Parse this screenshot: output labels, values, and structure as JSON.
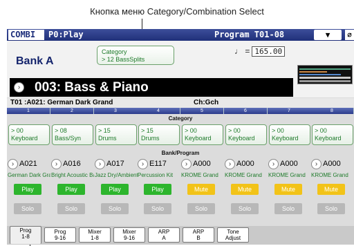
{
  "caption": "Кнопка меню Category/Combination Select",
  "header": {
    "mode": "COMBI",
    "page": "P0:Play",
    "program": "Program T01-08",
    "menu_icon": "chevron-down-icon",
    "lock_icon": "lock-icon"
  },
  "top": {
    "bank_label": "Bank A",
    "category_line1": "Category",
    "category_line2": "> 12 BassSplits",
    "tempo_symbol": "♩ =",
    "tempo_value": "165.00",
    "name": "003: Bass & Piano"
  },
  "info": {
    "timbre": "T01 :A021: German Dark Grand",
    "channel": "Ch:Gch"
  },
  "sections": {
    "category": "Category",
    "bank_program": "Bank/Program"
  },
  "columns": [
    {
      "num": "1",
      "cat_id": "> 00",
      "cat_name": "Keyboard",
      "bp": "A021",
      "pname": "German Dark Grand",
      "state": "Play",
      "solo": "Solo"
    },
    {
      "num": "2",
      "cat_id": "> 08",
      "cat_name": "Bass/Syn",
      "bp": "A016",
      "pname": "Bright Acoustic Bass",
      "state": "Play",
      "solo": "Solo"
    },
    {
      "num": "3",
      "cat_id": "> 15",
      "cat_name": "Drums",
      "bp": "A017",
      "pname": "Jazz Dry/Ambient",
      "state": "Play",
      "solo": "Solo"
    },
    {
      "num": "4",
      "cat_id": "> 15",
      "cat_name": "Drums",
      "bp": "E117",
      "pname": "Percussion Kit",
      "state": "Play",
      "solo": "Solo"
    },
    {
      "num": "5",
      "cat_id": "> 00",
      "cat_name": "Keyboard",
      "bp": "A000",
      "pname": "KROME Grand",
      "state": "Mute",
      "solo": "Solo"
    },
    {
      "num": "6",
      "cat_id": "> 00",
      "cat_name": "Keyboard",
      "bp": "A000",
      "pname": "KROME Grand",
      "state": "Mute",
      "solo": "Solo"
    },
    {
      "num": "7",
      "cat_id": "> 00",
      "cat_name": "Keyboard",
      "bp": "A000",
      "pname": "KROME Grand",
      "state": "Mute",
      "solo": "Solo"
    },
    {
      "num": "8",
      "cat_id": "> 00",
      "cat_name": "Keyboard",
      "bp": "A000",
      "pname": "KROME Grand",
      "state": "Mute",
      "solo": "Solo"
    }
  ],
  "tabs": [
    {
      "l1": "Prog",
      "l2": "1-8",
      "active": true
    },
    {
      "l1": "Prog",
      "l2": "9-16"
    },
    {
      "l1": "Mixer",
      "l2": "1-8"
    },
    {
      "l1": "Mixer",
      "l2": "9-16"
    },
    {
      "l1": "ARP",
      "l2": "A"
    },
    {
      "l1": "ARP",
      "l2": "B"
    },
    {
      "l1": "Tone",
      "l2": "Adjust"
    }
  ],
  "colors": {
    "play": "#2db52d",
    "mute": "#f2c318",
    "solo": "#b8b8b8",
    "category_text": "#1e7a2a"
  }
}
